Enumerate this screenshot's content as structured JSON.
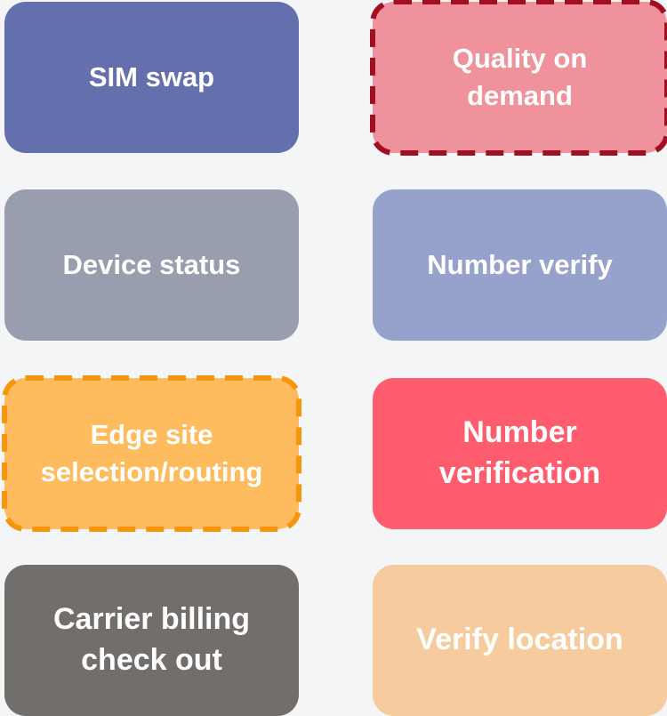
{
  "tiles": [
    {
      "label": "SIM swap",
      "color": "#6370ad"
    },
    {
      "label": "Quality on demand",
      "lines": [
        "Quality on",
        "demand"
      ],
      "color": "#ef929c",
      "border_color": "#a20f22",
      "border_style": "dashed"
    },
    {
      "label": "Device status",
      "color": "#999eae"
    },
    {
      "label": "Number verify",
      "color": "#96a2cc"
    },
    {
      "label": "Edge site selection/routing",
      "lines": [
        "Edge site",
        "selection/routing"
      ],
      "color": "#ffbc5f",
      "border_color": "#f5960c",
      "border_style": "dashed"
    },
    {
      "label": "Number verification",
      "lines": [
        "Number",
        "verification"
      ],
      "color": "#ff5c6e"
    },
    {
      "label": "Carrier billing check out",
      "lines": [
        "Carrier billing",
        "check out"
      ],
      "color": "#726e6c"
    },
    {
      "label": "Verify location",
      "color": "#f6cb9e"
    }
  ]
}
